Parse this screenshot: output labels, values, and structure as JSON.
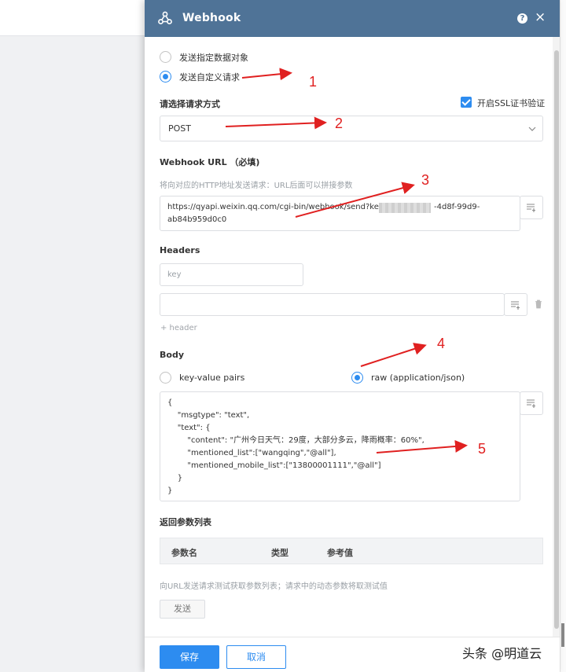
{
  "dialog": {
    "title": "Webhook",
    "help_icon_glyph": "?",
    "close_icon_glyph": "×"
  },
  "send_mode": {
    "options": [
      "发送指定数据对象",
      "发送自定义请求"
    ],
    "selected": "发送自定义请求"
  },
  "request": {
    "method_label": "请选择请求方式",
    "ssl_label": "开启SSL证书验证",
    "ssl_checked": true,
    "method_value": "POST"
  },
  "url": {
    "label": "Webhook URL （必填)",
    "hint": "将向对应的HTTP地址发送请求：URL后面可以拼接参数",
    "value_line1_start": "https://qyapi.weixin.qq.com/cgi-bin/webhook/send?key=1",
    "value_line1_end": "-4d8f-99d9-",
    "value_line2": "ab84b959d0c0"
  },
  "headers": {
    "label": "Headers",
    "key_placeholder": "key",
    "add_link": "+ header"
  },
  "body": {
    "label": "Body",
    "option_kv": "key-value pairs",
    "option_raw": "raw (application/json)",
    "selected": "raw (application/json)",
    "json_lines": [
      "{",
      "    \"msgtype\": \"text\",",
      "    \"text\": {",
      "        \"content\": \"广州今日天气：29度，大部分多云，降雨概率：60%\",",
      "        \"mentioned_list\":[\"wangqing\",\"@all\"],",
      "        \"mentioned_mobile_list\":[\"13800001111\",\"@all\"]",
      "    }",
      "}"
    ]
  },
  "return_params": {
    "label": "返回参数列表",
    "columns": [
      "参数名",
      "类型",
      "参考值"
    ],
    "hint": "向URL发送请求测试获取参数列表；请求中的动态参数将取测试值",
    "send_button": "发送"
  },
  "footer": {
    "save": "保存",
    "cancel": "取消"
  },
  "annotations": [
    "1",
    "2",
    "3",
    "4",
    "5"
  ],
  "watermark": "头条 @明道云",
  "colors": {
    "header_bg": "#4f7397",
    "primary": "#2d8cf0",
    "annotation": "#e02020"
  }
}
